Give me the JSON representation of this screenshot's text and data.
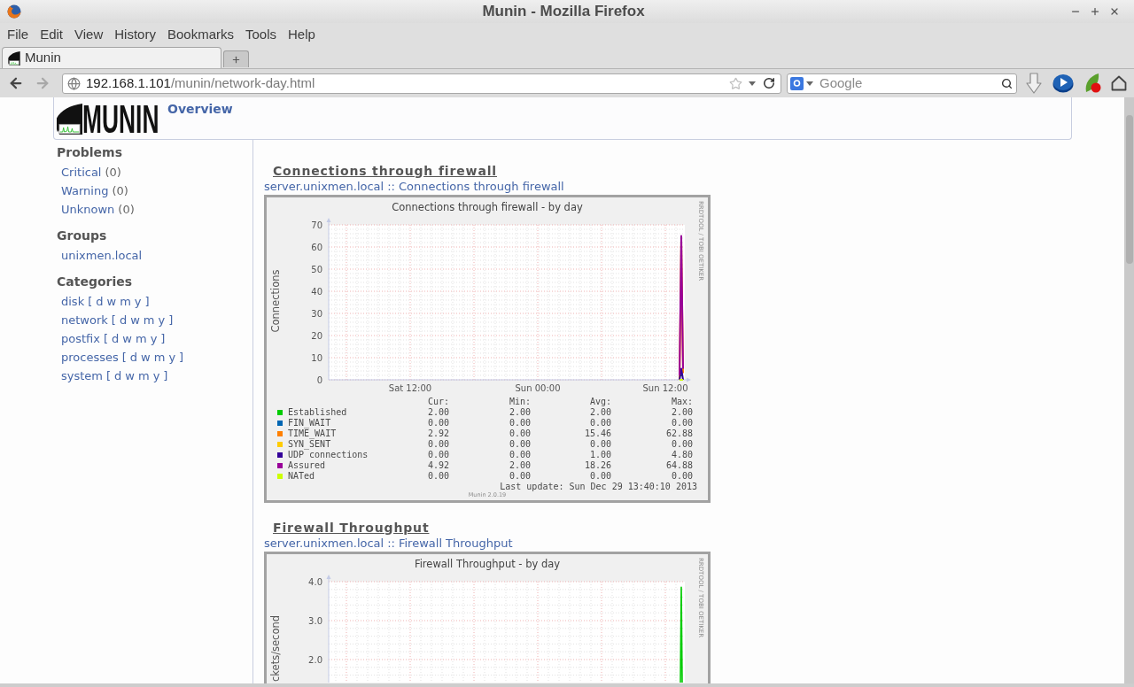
{
  "window": {
    "title": "Munin - Mozilla Firefox"
  },
  "menu": [
    "File",
    "Edit",
    "View",
    "History",
    "Bookmarks",
    "Tools",
    "Help"
  ],
  "tabs": [
    {
      "label": "Munin",
      "selected": true
    }
  ],
  "address_bar": {
    "host": "192.168.1.101",
    "path": "/munin/network-day.html"
  },
  "search": {
    "placeholder": "Google"
  },
  "header": {
    "logo": "MUNIN",
    "link": "Overview"
  },
  "sidebar": [
    {
      "title": "Problems",
      "items": [
        {
          "label": "Critical",
          "count": "(0)"
        },
        {
          "label": "Warning",
          "count": "(0)"
        },
        {
          "label": "Unknown",
          "count": "(0)"
        }
      ]
    },
    {
      "title": "Groups",
      "items": [
        {
          "label": "unixmen.local"
        }
      ]
    },
    {
      "title": "Categories",
      "items": [
        {
          "label": "disk",
          "open": "[",
          "periods": [
            "d",
            "w",
            "m",
            "y"
          ],
          "close": "]"
        },
        {
          "label": "network",
          "open": "[",
          "periods": [
            "d",
            "w",
            "m",
            "y"
          ],
          "close": "]"
        },
        {
          "label": "postfix",
          "open": "[",
          "periods": [
            "d",
            "w",
            "m",
            "y"
          ],
          "close": "]"
        },
        {
          "label": "processes",
          "open": "[",
          "periods": [
            "d",
            "w",
            "m",
            "y"
          ],
          "close": "]"
        },
        {
          "label": "system",
          "open": "[",
          "periods": [
            "d",
            "w",
            "m",
            "y"
          ],
          "close": "]"
        }
      ]
    }
  ],
  "graphs": [
    {
      "heading": "Connections through firewall",
      "host": "server.unixmen.local",
      "separator": "::",
      "link": "Connections through firewall",
      "title": "Connections through firewall - by day",
      "ylabel": "Connections",
      "y_labels": [
        "70",
        "60",
        "50",
        "40",
        "30",
        "20",
        "10",
        "0"
      ],
      "x_labels": [
        "Sat 12:00",
        "Sun 00:00",
        "Sun 12:00"
      ],
      "credit": "RRDTOOL / TOBI OETIKER",
      "legend": {
        "columns": [
          "Cur:",
          "Min:",
          "Avg:",
          "Max:"
        ],
        "rows": [
          {
            "name": "Established",
            "color": "#00cc00",
            "values": [
              "2.00",
              "2.00",
              "2.00",
              "2.00"
            ]
          },
          {
            "name": "FIN_WAIT",
            "color": "#0066b3",
            "values": [
              "0.00",
              "0.00",
              "0.00",
              "0.00"
            ]
          },
          {
            "name": "TIME_WAIT",
            "color": "#ff8000",
            "values": [
              "2.92",
              "0.00",
              "15.46",
              "62.88"
            ]
          },
          {
            "name": "SYN_SENT",
            "color": "#ffcc00",
            "values": [
              "0.00",
              "0.00",
              "0.00",
              "0.00"
            ]
          },
          {
            "name": "UDP connections",
            "color": "#330099",
            "values": [
              "0.00",
              "0.00",
              "1.00",
              "4.80"
            ]
          },
          {
            "name": "Assured",
            "color": "#990099",
            "values": [
              "4.92",
              "2.00",
              "18.26",
              "64.88"
            ]
          },
          {
            "name": "NATed",
            "color": "#ccff00",
            "values": [
              "0.00",
              "0.00",
              "0.00",
              "0.00"
            ]
          }
        ]
      },
      "last_update": "Last update: Sun Dec 29 13:40:10 2013",
      "version": "Munin 2.0.19"
    },
    {
      "heading": "Firewall Throughput",
      "host": "server.unixmen.local",
      "separator": "::",
      "link": "Firewall Throughput",
      "title": "Firewall Throughput - by day",
      "ylabel": "ckets/second",
      "y_labels": [
        "4.0",
        "3.0",
        "2.0"
      ],
      "credit": "RRDTOOL / TOBI OETIKER"
    }
  ]
}
